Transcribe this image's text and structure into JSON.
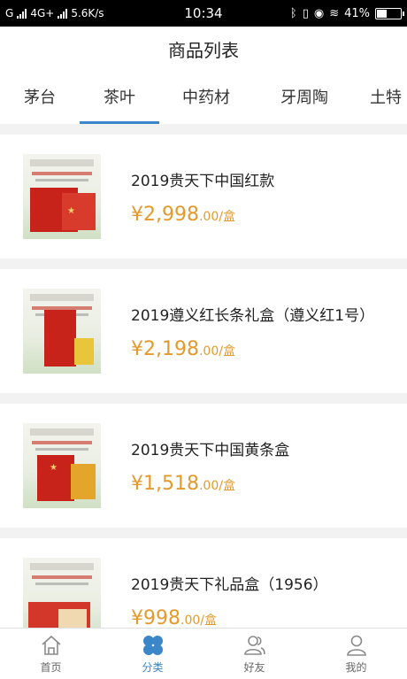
{
  "status_bar": {
    "carrier": "G",
    "network": "4G+",
    "speed": "5.6K/s",
    "time": "10:34",
    "battery": "41%",
    "battery_level": 0.41
  },
  "header": {
    "title": "商品列表"
  },
  "tabs": [
    {
      "label": "茅台",
      "active": false
    },
    {
      "label": "茶叶",
      "active": true
    },
    {
      "label": "中药材",
      "active": false
    },
    {
      "label": "牙周陶",
      "active": false
    },
    {
      "label": "土特",
      "active": false
    }
  ],
  "products": [
    {
      "title": "2019贵天下中国红款",
      "price_symbol": "¥",
      "price_main": "2,998",
      "price_decimal": ".00",
      "price_unit": "/盒"
    },
    {
      "title": "2019遵义红长条礼盒（遵义红1号）",
      "price_symbol": "¥",
      "price_main": "2,198",
      "price_decimal": ".00",
      "price_unit": "/盒"
    },
    {
      "title": "2019贵天下中国黄条盒",
      "price_symbol": "¥",
      "price_main": "1,518",
      "price_decimal": ".00",
      "price_unit": "/盒"
    },
    {
      "title": "2019贵天下礼品盒（1956）",
      "price_symbol": "¥",
      "price_main": "998",
      "price_decimal": ".00",
      "price_unit": "/盒"
    }
  ],
  "bottom_nav": [
    {
      "label": "首页",
      "icon": "home-icon",
      "active": false
    },
    {
      "label": "分类",
      "icon": "category-icon",
      "active": true
    },
    {
      "label": "好友",
      "icon": "friends-icon",
      "active": false
    },
    {
      "label": "我的",
      "icon": "profile-icon",
      "active": false
    }
  ],
  "colors": {
    "accent": "#3a86c8",
    "price": "#e39a2d"
  }
}
